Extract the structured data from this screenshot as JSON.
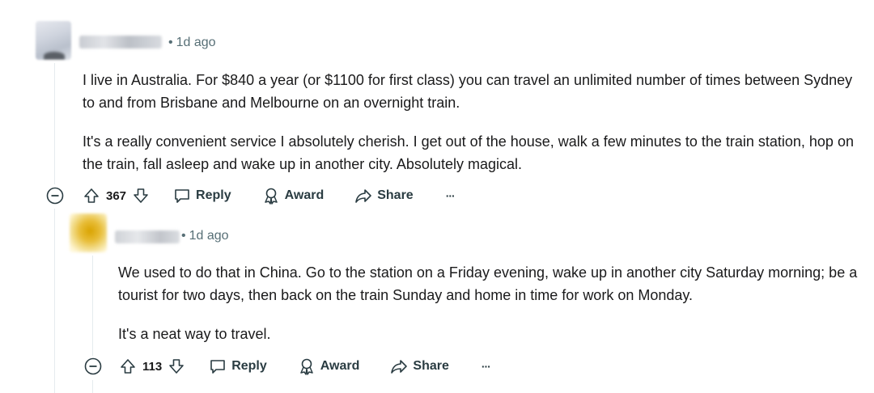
{
  "comments": [
    {
      "time": "1d ago",
      "paragraphs": [
        "I live in Australia. For $840 a year (or $1100 for first class) you can travel an unlimited number of times between Sydney to and from Brisbane and Melbourne on an overnight train.",
        "It's a really convenient service I absolutely cherish. I get out of the house, walk a few minutes to the train station, hop on the train, fall asleep and wake up in another city. Absolutely magical."
      ],
      "score": "367",
      "actions": {
        "reply": "Reply",
        "award": "Award",
        "share": "Share",
        "more": "···"
      }
    },
    {
      "time": "1d ago",
      "paragraphs": [
        "We used to do that in China. Go to the station on a Friday evening, wake up in another city Saturday morning; be a tourist for two days, then back on the train Sunday and home in time for work on Monday.",
        "It's a neat way to travel."
      ],
      "score": "113",
      "actions": {
        "reply": "Reply",
        "award": "Award",
        "share": "Share",
        "more": "···"
      }
    }
  ],
  "icons": [
    "collapse-icon",
    "upvote-icon",
    "downvote-icon",
    "reply-icon",
    "award-icon",
    "share-icon",
    "more-icon"
  ]
}
